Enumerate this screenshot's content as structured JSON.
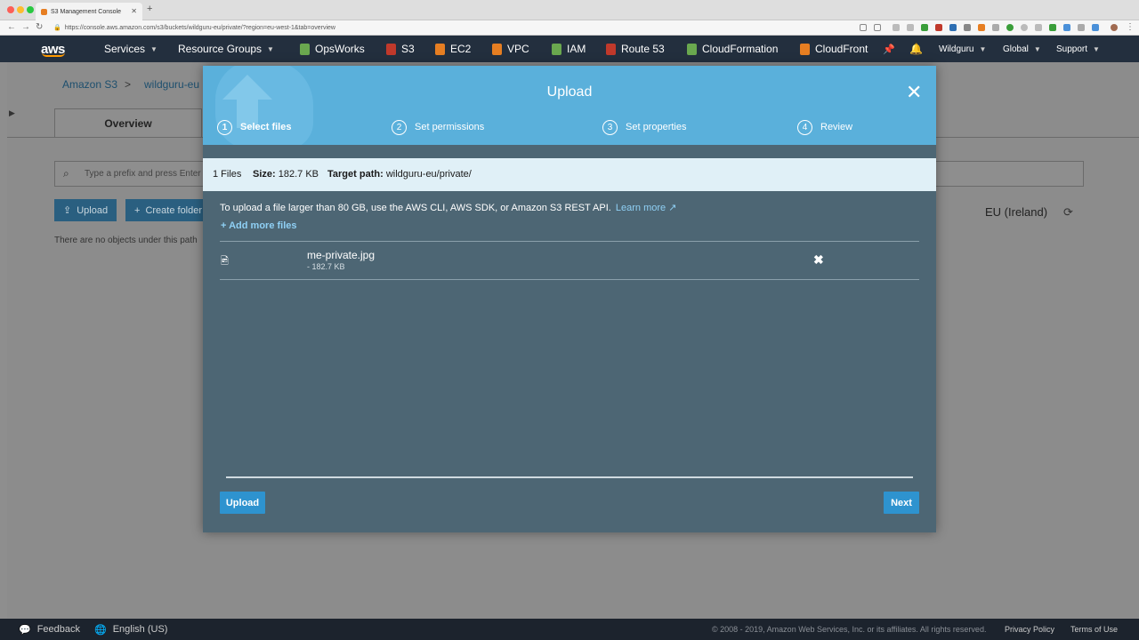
{
  "browser": {
    "tab_title": "S3 Management Console",
    "tab_close": "✕",
    "new_tab": "+",
    "url": "https://console.aws.amazon.com/s3/buckets/wildguru-eu/private/?region=eu-west-1&tab=overview",
    "traffic_colors": [
      "#fc5f57",
      "#fdbc2e",
      "#28c840"
    ]
  },
  "aws_nav": {
    "logo": "aws",
    "services": "Services",
    "resource_groups": "Resource Groups",
    "shortcuts": [
      {
        "label": "OpsWorks",
        "color": "#6aa84f"
      },
      {
        "label": "S3",
        "color": "#c0392b"
      },
      {
        "label": "EC2",
        "color": "#e67e22"
      },
      {
        "label": "VPC",
        "color": "#e67e22"
      },
      {
        "label": "IAM",
        "color": "#6aa84f"
      },
      {
        "label": "Route 53",
        "color": "#c0392b"
      },
      {
        "label": "CloudFormation",
        "color": "#6aa84f"
      },
      {
        "label": "CloudFront",
        "color": "#e67e22"
      }
    ],
    "account": "Wildguru",
    "region": "Global",
    "support": "Support"
  },
  "background": {
    "breadcrumb_root": "Amazon S3",
    "breadcrumb_sep": ">",
    "breadcrumb_bucket": "wildguru-eu",
    "tab_overview": "Overview",
    "search_placeholder": "Type a prefix and press Enter",
    "upload_btn": "Upload",
    "create_folder_btn": "Create folder",
    "empty_note": "There are no objects under this path",
    "region": "EU (Ireland)"
  },
  "modal": {
    "title": "Upload",
    "steps": [
      {
        "num": "1",
        "label": "Select files"
      },
      {
        "num": "2",
        "label": "Set permissions"
      },
      {
        "num": "3",
        "label": "Set properties"
      },
      {
        "num": "4",
        "label": "Review"
      }
    ],
    "info": {
      "files": "1 Files",
      "size_label": "Size:",
      "size_value": "182.7 KB",
      "target_label": "Target path:",
      "target_value": "wildguru-eu/private/"
    },
    "note": "To upload a file larger than 80 GB, use the AWS CLI, AWS SDK, or Amazon S3 REST API.",
    "learn_more": "Learn more",
    "add_more": "Add more files",
    "files": [
      {
        "name": "me-private.jpg",
        "size": "- 182.7 KB"
      }
    ],
    "progress_fraction": 0,
    "upload_button": "Upload",
    "next_button": "Next"
  },
  "footer": {
    "feedback": "Feedback",
    "language": "English (US)",
    "copyright": "© 2008 - 2019, Amazon Web Services, Inc. or its affiliates. All rights reserved.",
    "privacy": "Privacy Policy",
    "terms": "Terms of Use"
  }
}
